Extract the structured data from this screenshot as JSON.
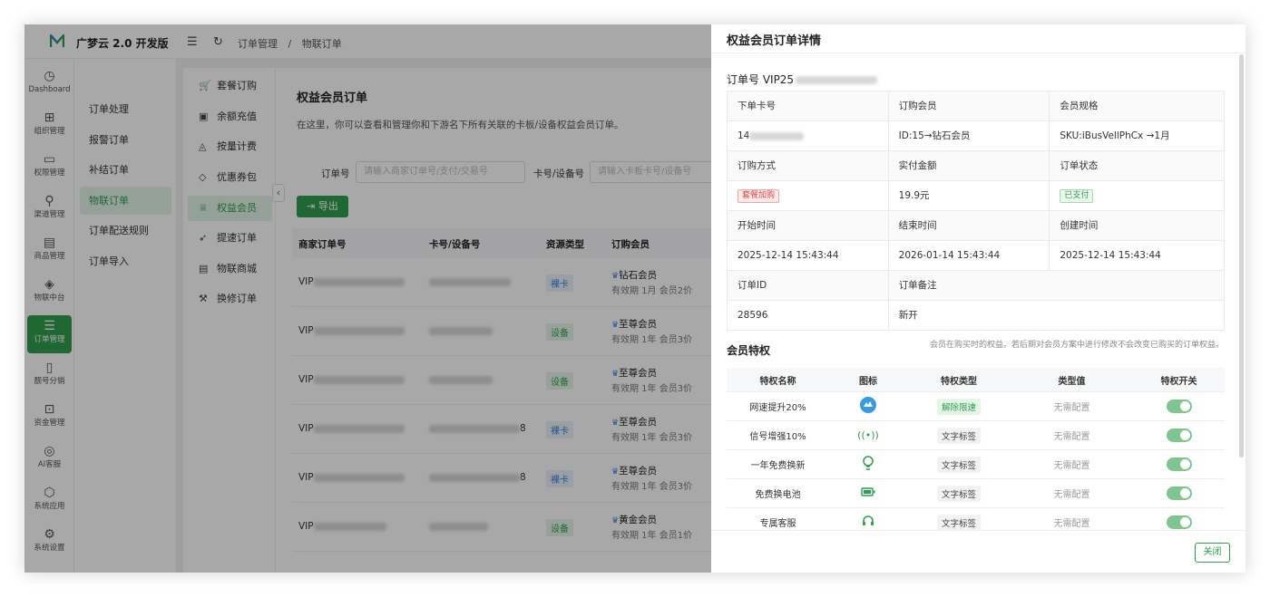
{
  "app": {
    "name": "广梦云 2.0 开发版"
  },
  "breadcrumb": [
    "订单管理",
    "/",
    "物联订单"
  ],
  "rail": [
    {
      "icon": "◷",
      "label": "Dashboard"
    },
    {
      "icon": "⊞",
      "label": "组织管理"
    },
    {
      "icon": "▭",
      "label": "权限管理"
    },
    {
      "icon": "⚲",
      "label": "渠道管理"
    },
    {
      "icon": "▤",
      "label": "商品管理"
    },
    {
      "icon": "◈",
      "label": "物联中台"
    },
    {
      "icon": "☰",
      "label": "订单管理"
    },
    {
      "icon": "▯",
      "label": "靓号分销"
    },
    {
      "icon": "⊡",
      "label": "资金管理"
    },
    {
      "icon": "◎",
      "label": "AI客服"
    },
    {
      "icon": "⬡",
      "label": "系统应用"
    },
    {
      "icon": "⚙",
      "label": "系统设置"
    }
  ],
  "submenu": [
    "订单处理",
    "报警订单",
    "补结订单",
    "物联订单",
    "订单配送规则",
    "订单导入"
  ],
  "menu2": [
    {
      "icon": "🛒",
      "label": "套餐订购"
    },
    {
      "icon": "▣",
      "label": "余额充值"
    },
    {
      "icon": "◬",
      "label": "按量计费"
    },
    {
      "icon": "◇",
      "label": "优惠券包"
    },
    {
      "icon": "♕",
      "label": "权益会员"
    },
    {
      "icon": "➶",
      "label": "提速订单"
    },
    {
      "icon": "▤",
      "label": "物联商城"
    },
    {
      "icon": "⚒",
      "label": "换修订单"
    }
  ],
  "page": {
    "title": "权益会员订单",
    "desc": "在这里，你可以查看和管理你和下游名下所有关联的卡板/设备权益会员订单。",
    "filter_order_label": "订单号",
    "filter_order_placeholder": "请输入商家订单号/支付/交易号",
    "filter_card_label": "卡号/设备号",
    "filter_card_placeholder": "请输入卡板卡号/设备号",
    "export_label": "导出"
  },
  "table": {
    "headers": [
      "商家订单号",
      "卡号/设备号",
      "资源类型",
      "订购会员"
    ],
    "rows": [
      {
        "order": "VIP",
        "card": "",
        "type": "裸卡",
        "tier": "钻石会员",
        "meta": "有效期 1月   会员2价"
      },
      {
        "order": "VIP",
        "card": "",
        "type": "设备",
        "tier": "至尊会员",
        "meta": "有效期 1年   会员3价"
      },
      {
        "order": "VIP",
        "card": "",
        "type": "设备",
        "tier": "至尊会员",
        "meta": "有效期 1年   会员3价"
      },
      {
        "order": "VIP",
        "card": "8",
        "type": "裸卡",
        "tier": "至尊会员",
        "meta": "有效期 1年   会员3价"
      },
      {
        "order": "VIP",
        "card": "8",
        "type": "裸卡",
        "tier": "至尊会员",
        "meta": "有效期 1年   会员3价"
      },
      {
        "order": "VIP",
        "card": "",
        "type": "设备",
        "tier": "黄金会员",
        "meta": "有效期 1年   会员1价"
      }
    ]
  },
  "drawer": {
    "title": "权益会员订单详情",
    "order_no_prefix": "订单号 VIP25",
    "grid": {
      "row1_labels": [
        "下单卡号",
        "订购会员",
        "会员规格"
      ],
      "row1_values": [
        "14",
        "ID:15→钻石会员",
        "SKU:iBusVellPhCx →1月"
      ],
      "row2_labels": [
        "订购方式",
        "实付金额",
        "订单状态"
      ],
      "row2_values": [
        "套餐加购",
        "19.9元",
        "已支付"
      ],
      "row3_labels": [
        "开始时间",
        "结束时间",
        "创建时间"
      ],
      "row3_values": [
        "2025-12-14 15:43:44",
        "2026-01-14 15:43:44",
        "2025-12-14 15:43:44"
      ],
      "row4_labels": [
        "订单ID",
        "订单备注"
      ],
      "row4_values": [
        "28596",
        "新开"
      ]
    },
    "priv_title": "会员特权",
    "priv_note": "会员在购买时的权益。若后期对会员方案中进行修改不会改变已购买的订单权益。",
    "priv_headers": [
      "特权名称",
      "图标",
      "特权类型",
      "类型值",
      "特权开关"
    ],
    "privileges": [
      {
        "name": "网速提升20%",
        "icon": "speed-badge-icon",
        "type": "解除限速",
        "value": "无需配置",
        "enabled": true
      },
      {
        "name": "信号增强10%",
        "icon": "signal-icon",
        "type": "文字标签",
        "value": "无需配置",
        "enabled": true
      },
      {
        "name": "一年免费换新",
        "icon": "bulb-icon",
        "type": "文字标签",
        "value": "无需配置",
        "enabled": true
      },
      {
        "name": "免费换电池",
        "icon": "battery-icon",
        "type": "文字标签",
        "value": "无需配置",
        "enabled": true
      },
      {
        "name": "专属客服",
        "icon": "headset-icon",
        "type": "文字标签",
        "value": "无需配置",
        "enabled": true
      }
    ],
    "close_label": "关闭"
  },
  "colors": {
    "accent": "#2f9e4f",
    "raw_tag": "#3a7fd6",
    "danger": "#dd4444"
  }
}
